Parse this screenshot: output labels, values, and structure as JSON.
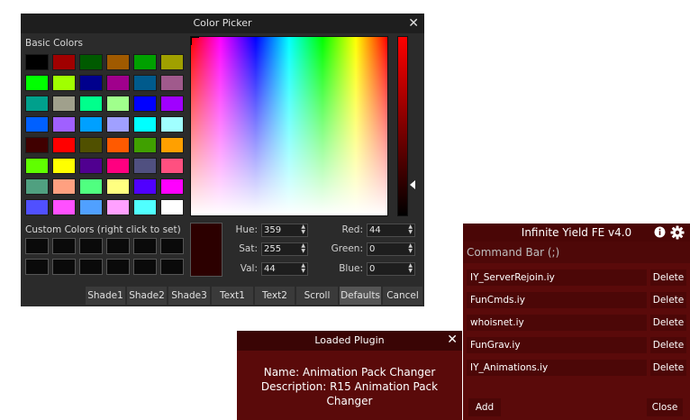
{
  "picker": {
    "title": "Color Picker",
    "close": "✕",
    "basic_label": "Basic Colors",
    "custom_label": "Custom Colors (right click to set)",
    "basic_colors": [
      "#000000",
      "#a00000",
      "#005a00",
      "#a05a00",
      "#00a000",
      "#a0a000",
      "#00ff00",
      "#a0ff00",
      "#00008c",
      "#a0008c",
      "#005a8c",
      "#a05a8c",
      "#00a08c",
      "#a0a08c",
      "#00ff8c",
      "#a0ff8c",
      "#0000ff",
      "#a000ff",
      "#0060ff",
      "#a060ff",
      "#00a0ff",
      "#a0a0ff",
      "#00ffff",
      "#a0ffff",
      "#400000",
      "#ff0000",
      "#505000",
      "#ff5a00",
      "#40a000",
      "#ffa000",
      "#60ff00",
      "#ffff00",
      "#500090",
      "#ff0080",
      "#505080",
      "#ff5080",
      "#50a080",
      "#ffa080",
      "#50ff80",
      "#ffff80",
      "#5000ff",
      "#ff00ff",
      "#5050ff",
      "#ff50ff",
      "#50a0ff",
      "#ffa0ff",
      "#50ffff",
      "#ffffff"
    ],
    "hue_label": "Hue:",
    "hue": "359",
    "sat_label": "Sat:",
    "sat": "255",
    "val_label": "Val:",
    "val": "44",
    "red_label": "Red:",
    "red": "44",
    "green_label": "Green:",
    "green": "0",
    "blue_label": "Blue:",
    "blue": "0",
    "preview_color": "#2c0000",
    "buttons": [
      "Shade1",
      "Shade2",
      "Shade3",
      "Text1",
      "Text2",
      "Scroll",
      "Defaults",
      "Cancel"
    ]
  },
  "plugin": {
    "title": "Loaded Plugin",
    "close": "✕",
    "name_line": "Name: Animation Pack Changer",
    "desc_line1": "Description: R15 Animation Pack",
    "desc_line2": "Changer"
  },
  "iy": {
    "title": "Infinite Yield FE v4.0",
    "command_bar": "Command Bar (;)",
    "plugins": [
      {
        "name": "IY_ServerRejoin.iy",
        "delete": "Delete"
      },
      {
        "name": "FunCmds.iy",
        "delete": "Delete"
      },
      {
        "name": "whoisnet.iy",
        "delete": "Delete"
      },
      {
        "name": "FunGrav.iy",
        "delete": "Delete"
      },
      {
        "name": "IY_Animations.iy",
        "delete": "Delete"
      }
    ],
    "add": "Add",
    "close": "Close"
  }
}
